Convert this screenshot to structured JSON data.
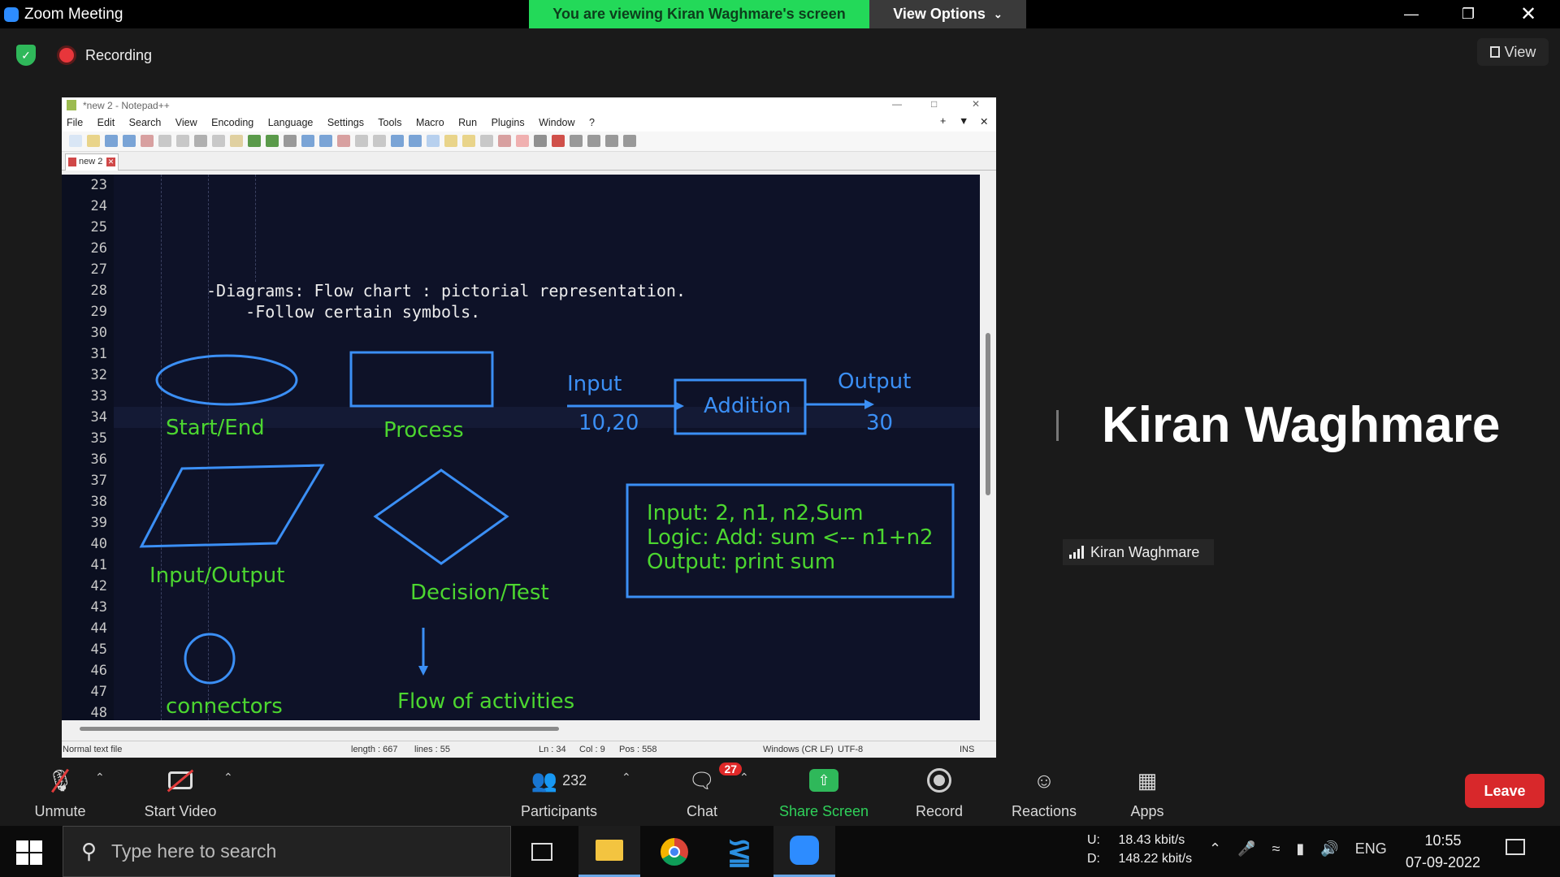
{
  "app": {
    "title": "Zoom Meeting"
  },
  "banner": {
    "viewing": "You are viewing Kiran Waghmare's screen",
    "view_options": "View Options"
  },
  "subheader": {
    "recording_label": "Recording",
    "view_label": "View"
  },
  "npp": {
    "title": "*new 2 - Notepad++",
    "menu": [
      "File",
      "Edit",
      "Search",
      "View",
      "Encoding",
      "Language",
      "Settings",
      "Tools",
      "Macro",
      "Run",
      "Plugins",
      "Window",
      "?"
    ],
    "tab_label": "new 2",
    "line_numbers": [
      "23",
      "24",
      "25",
      "26",
      "27",
      "28",
      "29",
      "30",
      "31",
      "32",
      "33",
      "34",
      "35",
      "36",
      "37",
      "38",
      "39",
      "40",
      "41",
      "42",
      "43",
      "44",
      "45",
      "46",
      "47",
      "48"
    ],
    "lines": {
      "l28": "-Diagrams: Flow chart : pictorial representation.",
      "l29": "    -Follow certain symbols."
    },
    "status": {
      "type": "Normal text file",
      "length": "length : 667",
      "lines": "lines : 55",
      "ln": "Ln : 34",
      "col": "Col : 9",
      "pos": "Pos : 558",
      "eol": "Windows (CR LF)",
      "enc": "UTF-8",
      "ins": "INS"
    }
  },
  "drawing": {
    "start_end": "Start/End",
    "process": "Process",
    "input": "Input",
    "input_values": "10,20",
    "addition": "Addition",
    "output": "Output",
    "output_value": "30",
    "input_output": "Input/Output",
    "decision": "Decision/Test",
    "connectors": "connectors",
    "flow": "Flow of activities",
    "box_line1": "Input: 2, n1, n2,Sum",
    "box_line2": "Logic: Add: sum <-- n1+n2",
    "box_line3": "Output: print sum"
  },
  "speaker": {
    "name": "Kiran Waghmare",
    "tag": "Kiran Waghmare"
  },
  "controls": {
    "unmute": "Unmute",
    "start_video": "Start Video",
    "participants": "Participants",
    "participants_count": "232",
    "chat": "Chat",
    "chat_badge": "27",
    "share": "Share Screen",
    "record": "Record",
    "reactions": "Reactions",
    "apps": "Apps",
    "leave": "Leave"
  },
  "taskbar": {
    "search_placeholder": "Type here to search",
    "net_up_label": "U:",
    "net_up": "18.43 kbit/s",
    "net_down_label": "D:",
    "net_down": "148.22 kbit/s",
    "lang": "ENG",
    "time": "10:55",
    "date": "07-09-2022"
  },
  "colors": {
    "zoom_blue": "#2d8cff",
    "banner_green": "#23d959",
    "leave_red": "#d8282b",
    "diagram_green": "#4cd630",
    "diagram_blue": "#3b8ff5",
    "editor_bg": "#0e1228"
  }
}
